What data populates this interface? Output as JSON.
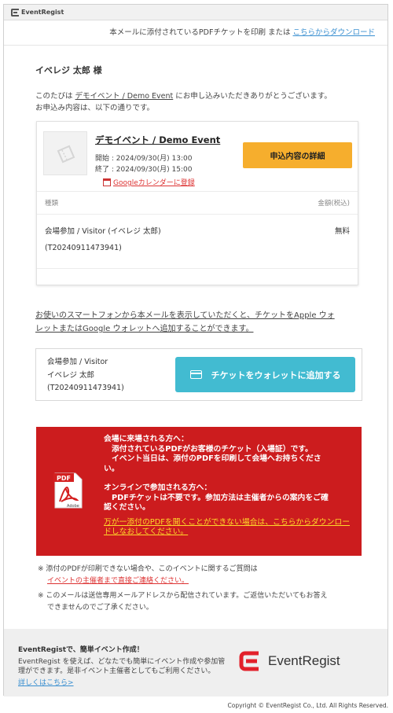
{
  "brand": {
    "small_logo_text": "EventRegist",
    "footer_logo_text": "EventRegist"
  },
  "print_bar": {
    "prefix": "本メールに添付されているPDFチケットを印刷 または ",
    "link": "こちらからダウンロード"
  },
  "greeting": "イベレジ 太郎 様",
  "intro": {
    "before": "このたびは",
    "event_link": "デモイベント / Demo Event",
    "after": "にお申し込みいただきありがとうございます。",
    "line2": "お申込み内容は、以下の通りです。"
  },
  "event_card": {
    "title": "デモイベント / Demo Event",
    "start": "開始 : 2024/09/30(月) 13:00",
    "end": "終了 : 2024/09/30(月) 15:00",
    "gcal_link": "Googleカレンダーに登録",
    "detail_button": "申込内容の詳細",
    "table_header_left": "種類",
    "table_header_right": "金額(税込)",
    "ticket_name": "会場参加 / Visitor (イベレジ 太郎)",
    "price": "無料",
    "ticket_number": "(T20240911473941)"
  },
  "wallet": {
    "text_line1": "お使いのスマートフォンから本メールを表示していただくと、チケットをApple ウォ",
    "text_line2": "レットまたはGoogle ウォレットへ追加することができます。",
    "ticket_type": "会場参加 / Visitor",
    "attendee": "イベレジ 太郎",
    "ticket_number": "(T20240911473941)",
    "button": "チケットをウォレットに追加する"
  },
  "notice": {
    "h1": "会場に来場される方へ：",
    "l1": "添付されているPDFがお客様のチケット（入場証）です。",
    "l2": "イベント当日は、添付のPDFを印刷して会場へお持ちくださ",
    "l3": "い。",
    "h2": "オンラインで参加される方へ：",
    "l4": "PDFチケットは不要です。参加方法は主催者からの案内をご確",
    "l5": "認ください。",
    "link1": "万が一添付のPDFを開くことができない場合は、こちらからダウンロー",
    "link2": "ドしなおしてください。",
    "pdf_label": "PDF",
    "adobe_label": "Adobe"
  },
  "notes": {
    "n1": "※ 添付のPDFが印刷できない場合や、このイベントに関するご質問は",
    "n1_link": "イベントの主催者まで直接ご連絡ください。",
    "n2a": "※ このメールは送信専用メールアドレスから配信されています。ご返信いただいてもお答え",
    "n2b": "できませんのでご了承ください。"
  },
  "footer": {
    "title": "EventRegistで、簡単イベント作成！",
    "body1": "EventRegist を使えば、どなたでも簡単にイベント作成や参加管",
    "body2": "理ができます。是非イベント主催者としてもご利用ください。",
    "link": "詳しくはこちら>"
  },
  "copyright": "Copyright © EventRegist Co., Ltd. All Rights Reserved.",
  "colors": {
    "accent_orange": "#f6ae2d",
    "wallet_blue": "#42bbd1",
    "notice_red": "#cc1c1e",
    "link_blue": "#3a8fd0",
    "link_red": "#dd3333",
    "brand_red": "#e2212b"
  }
}
